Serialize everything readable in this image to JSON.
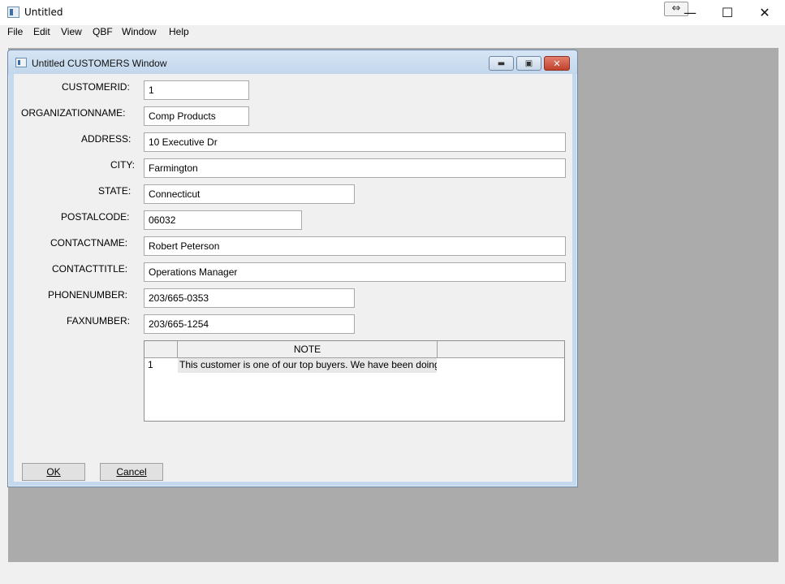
{
  "app": {
    "title": "Untitled",
    "resize_glyph": "⇔",
    "minimize_glyph": "—",
    "maximize_glyph": "☐",
    "close_glyph": "✕"
  },
  "menu": [
    "File",
    "Edit",
    "View",
    "QBF",
    "Window",
    "Help"
  ],
  "child_window": {
    "title": "Untitled CUSTOMERS Window",
    "minimize_glyph": "▬",
    "maximize_glyph": "▣",
    "close_glyph": "✕"
  },
  "fields": [
    {
      "label": "CUSTOMERID:",
      "value": "1"
    },
    {
      "label": "ORGANIZATIONNAME:",
      "value": "Comp Products"
    },
    {
      "label": "ADDRESS:",
      "value": "10 Executive Dr"
    },
    {
      "label": "CITY:",
      "value": "Farmington"
    },
    {
      "label": "STATE:",
      "value": "Connecticut"
    },
    {
      "label": "POSTALCODE:",
      "value": "06032"
    },
    {
      "label": "CONTACTNAME:",
      "value": "Robert Peterson"
    },
    {
      "label": "CONTACTTITLE:",
      "value": "Operations Manager"
    },
    {
      "label": "PHONENUMBER:",
      "value": "203/665-0353"
    },
    {
      "label": "FAXNUMBER:",
      "value": "203/665-1254"
    }
  ],
  "note_grid": {
    "column_header": "NOTE",
    "rows": [
      {
        "num": "1",
        "note": "This customer is one of our top buyers.  We have been doing"
      }
    ]
  },
  "buttons": {
    "ok": "OK",
    "cancel": "Cancel"
  },
  "colors": {
    "mdi_background": "#ababab",
    "close_button": "#c1402c"
  }
}
